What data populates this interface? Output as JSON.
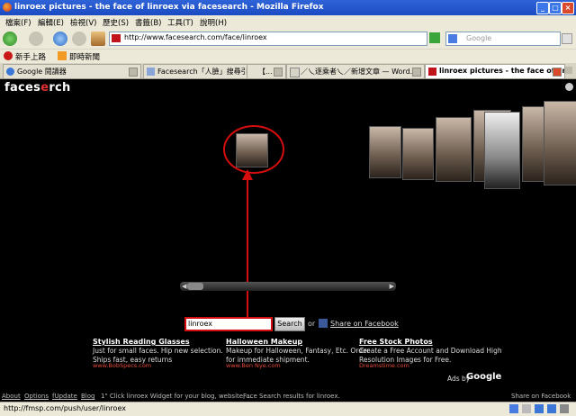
{
  "window": {
    "title": "linroex pictures - the face of linroex via facesearch - Mozilla Firefox"
  },
  "menu": [
    "檔案(F)",
    "編輯(E)",
    "檢視(V)",
    "歷史(S)",
    "書籤(B)",
    "工具(T)",
    "說明(H)"
  ],
  "nav": {
    "url": "http://www.facesearch.com/face/linroex",
    "search_placeholder": "Google"
  },
  "bookmarks": [
    "新手上路",
    "即時新聞"
  ],
  "tabs": [
    {
      "label": "Google 閱讀器",
      "active": false
    },
    {
      "label": "Facesearch「人臉」搜尋引擎",
      "active": false
    },
    {
      "label": "【...",
      "active": false
    },
    {
      "label": "／乀逐乘者乀／新增文章 — Word...",
      "active": false
    },
    {
      "label": "linroex pictures - the face of lin...",
      "active": true
    }
  ],
  "page": {
    "logo_pre": "faces",
    "logo_mid": "e",
    "logo_post": "rch",
    "search_value": "linroex",
    "search_button": "Search",
    "or_label": "or",
    "share_label": "Share on Facebook",
    "ads": [
      {
        "title": "Stylish Reading Glasses",
        "body": "Just for small faces. Hip new selection. Ships fast, easy returns",
        "url": "www.BobSpecs.com"
      },
      {
        "title": "Halloween Makeup",
        "body": "Makeup for Halloween, Fantasy, Etc. Order for immediate shipment.",
        "url": "www.Ben Nye.com"
      },
      {
        "title": "Free Stock Photos",
        "body": "Create a Free Account and Download High Resolution Images for Free.",
        "url": "Dreamstime.com"
      }
    ],
    "ads_by": "Ads by",
    "ads_brand": "Google",
    "footer_links": [
      "About",
      "Options",
      "fUpdate",
      "Blog"
    ],
    "footer_widget": "1\" Click linroex Widget for your blog, website, ...",
    "footer_center": "Face Search results for linroex.",
    "footer_right": "Share on Facebook"
  },
  "status": {
    "text": "http://fmsp.com/push/user/linroex"
  },
  "colors": {
    "highlight": "#d40e0e",
    "titlebar": "#2f63d8"
  }
}
